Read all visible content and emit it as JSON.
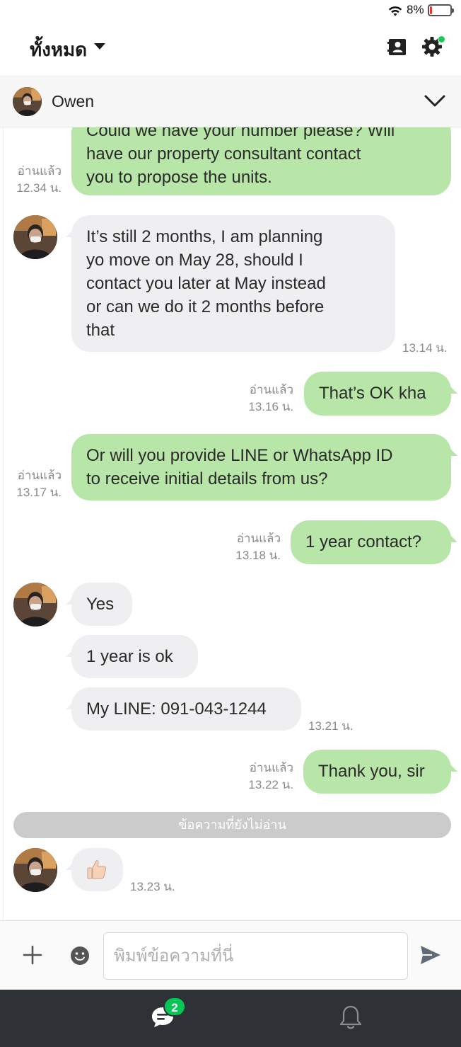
{
  "status_bar": {
    "battery_percent": "8%",
    "battery_level": 0.08
  },
  "top_bar": {
    "filter_label": "ทั้งหมด",
    "settings_notification": true
  },
  "chat_header": {
    "contact_name": "Owen"
  },
  "messages": {
    "m1": {
      "direction": "out",
      "lines": [
        "Could we have your number please? Will",
        "have our property consultant contact",
        "you to propose the units."
      ],
      "read": "อ่านแล้ว",
      "time": "12.34 น."
    },
    "m2": {
      "direction": "in",
      "lines": [
        "It’s still 2 months, I am planning",
        "yo move on May 28, should I",
        "contact you later at May instead",
        "or can we do it 2 months before",
        "that"
      ],
      "time": "13.14 น."
    },
    "m3": {
      "direction": "out",
      "text": "That’s OK kha",
      "read": "อ่านแล้ว",
      "time": "13.16 น."
    },
    "m4": {
      "direction": "out",
      "lines": [
        "Or will you provide LINE or WhatsApp ID",
        "to receive initial details from us?"
      ],
      "read": "อ่านแล้ว",
      "time": "13.17 น."
    },
    "m5": {
      "direction": "out",
      "text": "1 year contact?",
      "read": "อ่านแล้ว",
      "time": "13.18 น."
    },
    "m6": {
      "direction": "in",
      "text": "Yes"
    },
    "m7": {
      "direction": "in",
      "text": "1 year is ok"
    },
    "m8": {
      "direction": "in",
      "text": "My LINE: 091-043-1244",
      "time": "13.21 น."
    },
    "m9": {
      "direction": "out",
      "text": "Thank you, sir",
      "read": "อ่านแล้ว",
      "time": "13.22 น."
    },
    "unread_divider": "ข้อความที่ยังไม่อ่าน",
    "m10": {
      "direction": "in",
      "sticker": "thumbs-up",
      "time": "13.23 น."
    }
  },
  "input": {
    "placeholder": "พิมพ์ข้อความที่นี่"
  },
  "bottom_nav": {
    "chats_badge": "2"
  },
  "colors": {
    "outgoing_bubble": "#b8e6a8",
    "incoming_bubble": "#efeff1",
    "accent_green": "#06c755",
    "nav_bg": "#2e3136"
  }
}
